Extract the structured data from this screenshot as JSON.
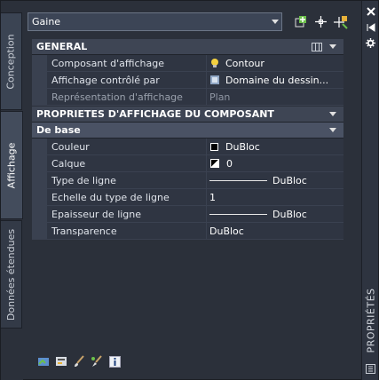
{
  "palette": {
    "title": "PROPRIÉTÉS",
    "left_tabs": [
      {
        "label": "Conception"
      },
      {
        "label": "Affichage"
      },
      {
        "label": "Données étendues"
      }
    ]
  },
  "selector": {
    "value": "Gaine"
  },
  "sections": {
    "general": {
      "title": "GENERAL",
      "rows": [
        {
          "name": "Composant d'affichage",
          "value": "Contour",
          "icon": "lightbulb-icon"
        },
        {
          "name": "Affichage contrôlé par",
          "value": "Domaine du dessin...",
          "icon": "drawing-icon"
        },
        {
          "name": "Représentation d'affichage",
          "value": "Plan",
          "icon": ""
        }
      ]
    },
    "component": {
      "title": "PROPRIETES D'AFFICHAGE DU COMPOSANT"
    },
    "base": {
      "title": "De base",
      "rows": [
        {
          "name": "Couleur",
          "value": "DuBloc",
          "icon": "color-swatch-icon"
        },
        {
          "name": "Calque",
          "value": "0",
          "icon": "layer-icon"
        },
        {
          "name": "Type de ligne",
          "value": "DuBloc",
          "icon": "linetype-icon"
        },
        {
          "name": "Echelle du type de ligne",
          "value": "1",
          "icon": ""
        },
        {
          "name": "Epaisseur de ligne",
          "value": "DuBloc",
          "icon": "lineweight-icon"
        },
        {
          "name": "Transparence",
          "value": "DuBloc",
          "icon": ""
        }
      ]
    }
  },
  "colors": {
    "panel_bg": "#2b303a",
    "row_bg": "#2f3542",
    "header_bg": "#3e4554",
    "accent_green": "#6cc04a"
  }
}
